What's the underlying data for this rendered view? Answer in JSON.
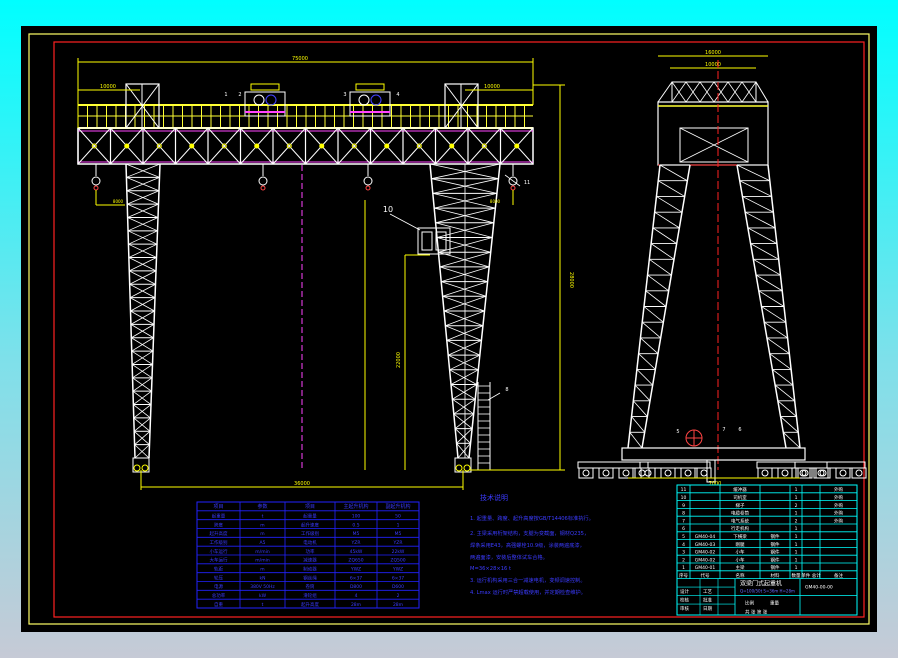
{
  "colors": {
    "background_top": "#00ffff",
    "canvas": "#000000",
    "frame": "#ffff66",
    "inner_frame": "#ff2222",
    "structure": "#ffffff",
    "walkway": "#ffff33",
    "girder_nodes": "#ff44ff",
    "dimension": "#ffff00",
    "notes": "#2222ff",
    "table": "#00ffff"
  },
  "dimensions": {
    "span_total": "75000",
    "cantilever_left": "10000",
    "cantilever_right": "10000",
    "leg_span": "36000",
    "lift_height": "28000",
    "lower_height": "22000",
    "hook_left": "8000",
    "hook_right": "8000",
    "side_top_outer": "16000",
    "side_top_inner": "10000",
    "side_base": "7000"
  },
  "callouts": [
    "1",
    "2",
    "3",
    "4",
    "10",
    "11",
    "8",
    "5",
    "6",
    "7"
  ],
  "notes": {
    "title": "技术说明",
    "lines": [
      "1. 起重量、跨度、起升高度按GB/T14406标准执行。",
      "2. 主梁采用桁架结构，支腿为变截面，钢材Q235，",
      "   焊条采用E43，高强螺栓10.9级，涂装两遍底漆，",
      "   两遍面漆，安装后整体试车合格。",
      "   M=36×28×16 t",
      "3. 运行机构采用三合一减速电机，变频调速控制。",
      "4. Lmax 运行时严禁超载使用，并定期检查维护。"
    ]
  },
  "spec_table": {
    "headers": [
      "项目",
      "参数",
      "项目",
      "主起升机构",
      "副起升机构"
    ],
    "rows": [
      [
        "起重量",
        "t",
        "起重量",
        "100",
        "50"
      ],
      [
        "跨度",
        "m",
        "起升速度",
        "0.5",
        "1"
      ],
      [
        "起升高度",
        "m",
        "工作级别",
        "M5",
        "M5"
      ],
      [
        "工作级别",
        "A5",
        "电动机",
        "YZR",
        "YZR"
      ],
      [
        "小车运行",
        "m/min",
        "功率",
        "45kW",
        "22kW"
      ],
      [
        "大车运行",
        "m/min",
        "减速器",
        "ZQ650",
        "ZQ500"
      ],
      [
        "轨距",
        "m",
        "制动器",
        "YWZ",
        "YWZ"
      ],
      [
        "轮压",
        "kN",
        "钢丝绳",
        "6×37",
        "6×37"
      ],
      [
        "电源",
        "380V 50Hz",
        "卷筒",
        "D800",
        "D600"
      ],
      [
        "总功率",
        "kW",
        "滑轮组",
        "4",
        "2"
      ],
      [
        "自重",
        "t",
        "起升高度",
        "28m",
        "28m"
      ]
    ]
  },
  "parts_table": {
    "rows": [
      [
        "11",
        "",
        "缓冲器",
        "",
        "1",
        "",
        "外购"
      ],
      [
        "10",
        "",
        "司机室",
        "",
        "1",
        "",
        "外购"
      ],
      [
        "9",
        "",
        "梯子",
        "",
        "2",
        "",
        "外购"
      ],
      [
        "8",
        "",
        "电缆卷筒",
        "",
        "1",
        "",
        "外购"
      ],
      [
        "7",
        "",
        "电气系统",
        "",
        "2",
        "",
        "外购"
      ],
      [
        "6",
        "",
        "行走机构",
        "",
        "1",
        "",
        ""
      ],
      [
        "5",
        "GM40-04",
        "下横梁",
        "钢件",
        "1",
        "",
        ""
      ],
      [
        "4",
        "GM40-03",
        "刚腿",
        "钢件",
        "1",
        "",
        ""
      ],
      [
        "3",
        "GM40-02",
        "小车",
        "钢件",
        "1",
        "",
        ""
      ],
      [
        "2",
        "GM40-02",
        "小车",
        "钢件",
        "1",
        "",
        ""
      ],
      [
        "1",
        "GM40-01",
        "主梁",
        "钢件",
        "1",
        "",
        ""
      ]
    ],
    "header": [
      "序号",
      "代号",
      "名称",
      "材料",
      "数量",
      "单件 总计",
      "备注"
    ],
    "title": "双梁门式起重机",
    "subtitle": "Q=100/50t S=36m H=28m",
    "drawing_no": "GM40-00-00",
    "sign_labels": [
      "设计",
      "校核",
      "审核",
      "工艺",
      "批准",
      "日期"
    ],
    "scale_label": "比例",
    "weight_label": "重量",
    "sheet_label": "共 张 第 张"
  }
}
